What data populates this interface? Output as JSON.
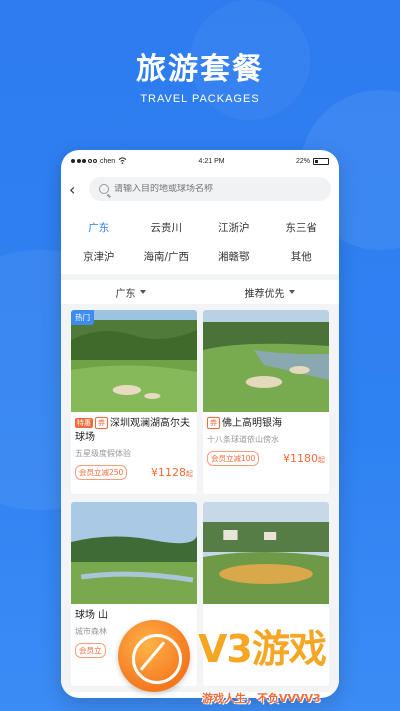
{
  "hero": {
    "title": "旅游套餐",
    "subtitle": "TRAVEL PACKAGES"
  },
  "status": {
    "carrier": "chen",
    "time": "4:21 PM",
    "battery": "22%"
  },
  "search": {
    "placeholder": "请输入目的地或球场名称"
  },
  "regions": [
    "广东",
    "云贵川",
    "江浙沪",
    "东三省",
    "京津沪",
    "海南/广西",
    "湘赣鄂",
    "其他"
  ],
  "filters": {
    "region": "广东",
    "sort": "推荐优先"
  },
  "cards": [
    {
      "hot": "热门",
      "tag1": "特惠",
      "tag2": "券",
      "title": "深圳观澜湖高尔夫球场",
      "desc": "五星级度假体验",
      "coupon": "会员立减250",
      "price": "¥1128",
      "unit": "起"
    },
    {
      "tag2": "券",
      "title": "佛上高明银海",
      "desc": "十八条球道依山傍水",
      "coupon": "会员立减100",
      "price": "¥1180",
      "unit": "起"
    },
    {
      "title": "球场 山",
      "desc": "城市森林",
      "coupon": "会员立"
    },
    {
      "title": ""
    }
  ],
  "brand": {
    "name": "V3游戏",
    "slogan": "游戏人生，不负VVVV3"
  }
}
